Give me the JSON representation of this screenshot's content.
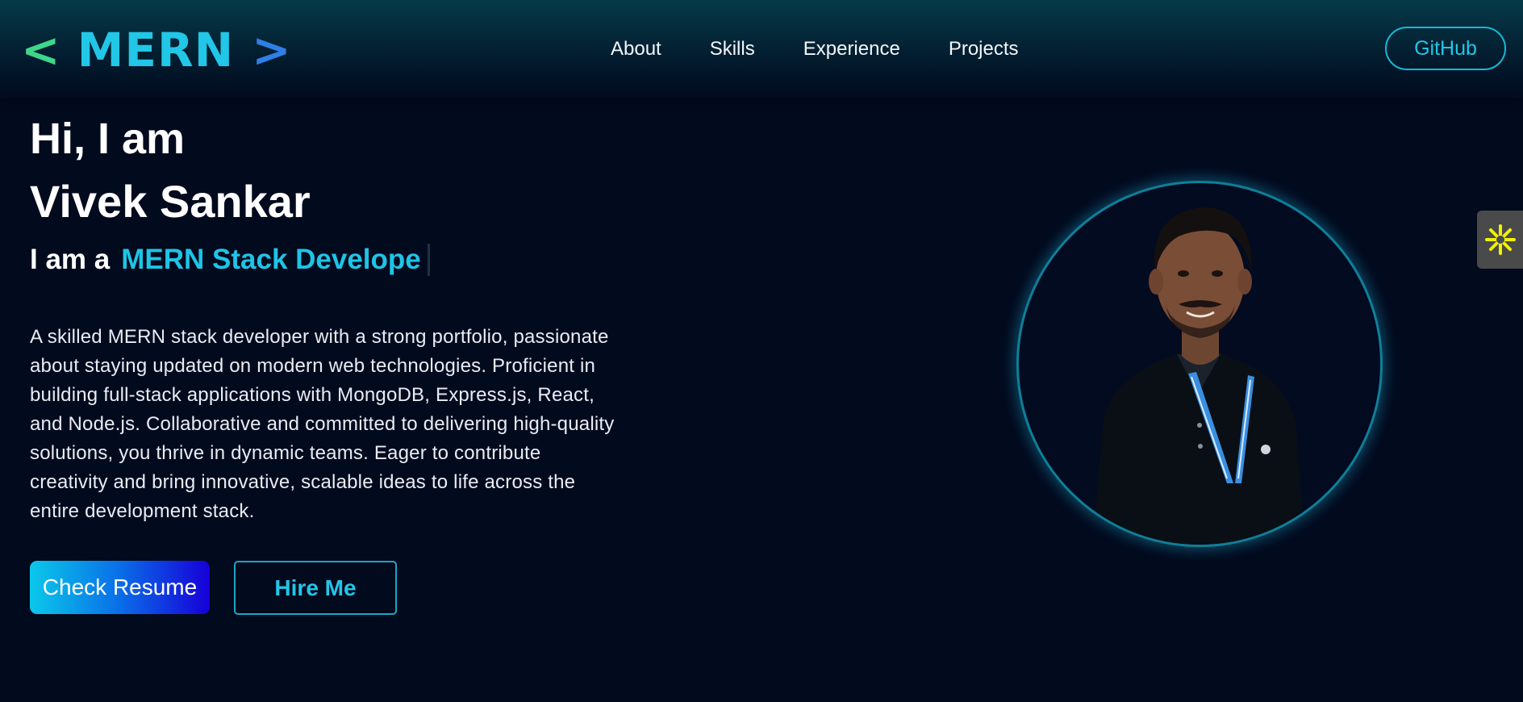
{
  "navbar": {
    "logo": {
      "left_bracket": "<",
      "text": "MERN",
      "right_bracket": ">"
    },
    "links": [
      {
        "label": "About"
      },
      {
        "label": "Skills"
      },
      {
        "label": "Experience"
      },
      {
        "label": "Projects"
      }
    ],
    "github_label": "GitHub"
  },
  "hero": {
    "greeting": "Hi, I am",
    "name": "Vivek Sankar",
    "role_prefix": "I am a",
    "role_typed": "MERN Stack Develope",
    "bio": "A skilled MERN stack developer with a strong portfolio, passionate about staying updated on modern web technologies. Proficient in building full-stack applications with MongoDB, Express.js, React, and Node.js. Collaborative and committed to delivering high-quality solutions, you thrive in dynamic teams. Eager to contribute creativity and bring innovative, scalable ideas to life across the entire development stack.",
    "primary_button": "Check Resume",
    "secondary_button": "Hire Me"
  },
  "icons": {
    "avatar": "profile-photo",
    "side_widget": "asterisk-icon"
  },
  "colors": {
    "background": "#020a1e",
    "accent": "#22c6e6",
    "logo_left_bracket": "#3ed68a",
    "logo_right_bracket": "#2f7fe6",
    "side_widget_glyph": "#f2f200"
  }
}
